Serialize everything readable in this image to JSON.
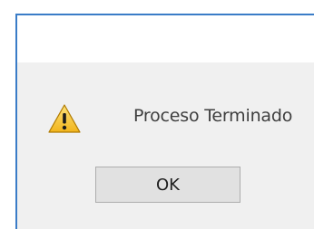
{
  "dialog": {
    "message": "Proceso Terminado",
    "icon": "warning-icon",
    "ok_label": "OK",
    "accent_color": "#3a7cc7",
    "warning_color": "#f4c22c"
  }
}
